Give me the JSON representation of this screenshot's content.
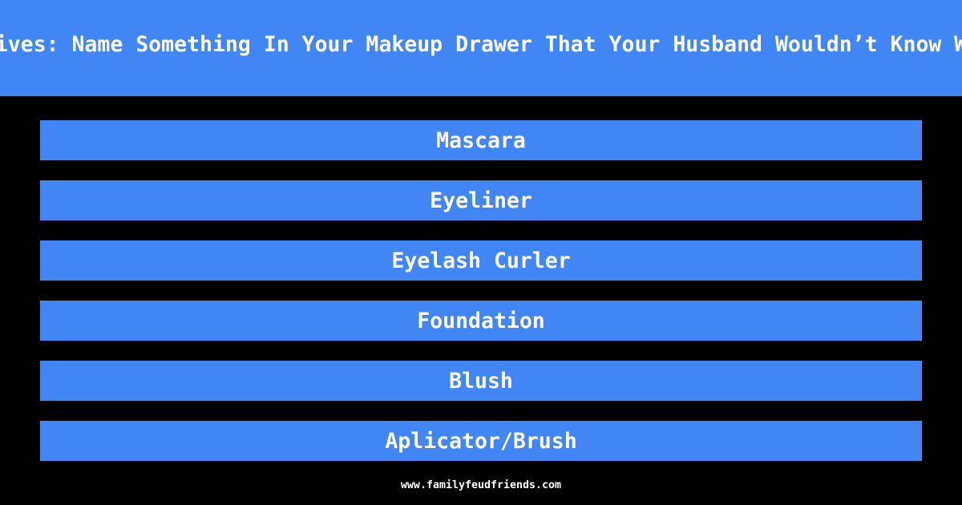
{
  "header": {
    "title": "ives: Name Something In Your Makeup Drawer That Your Husband Wouldn’t Know W"
  },
  "answers": [
    {
      "label": "Mascara"
    },
    {
      "label": "Eyeliner"
    },
    {
      "label": "Eyelash Curler"
    },
    {
      "label": "Foundation"
    },
    {
      "label": "Blush"
    },
    {
      "label": "Aplicator/Brush"
    }
  ],
  "footer": {
    "url": "www.familyfeudfriends.com"
  },
  "colors": {
    "accent": "#4285f4",
    "background": "#000000",
    "text": "#ffffff"
  }
}
